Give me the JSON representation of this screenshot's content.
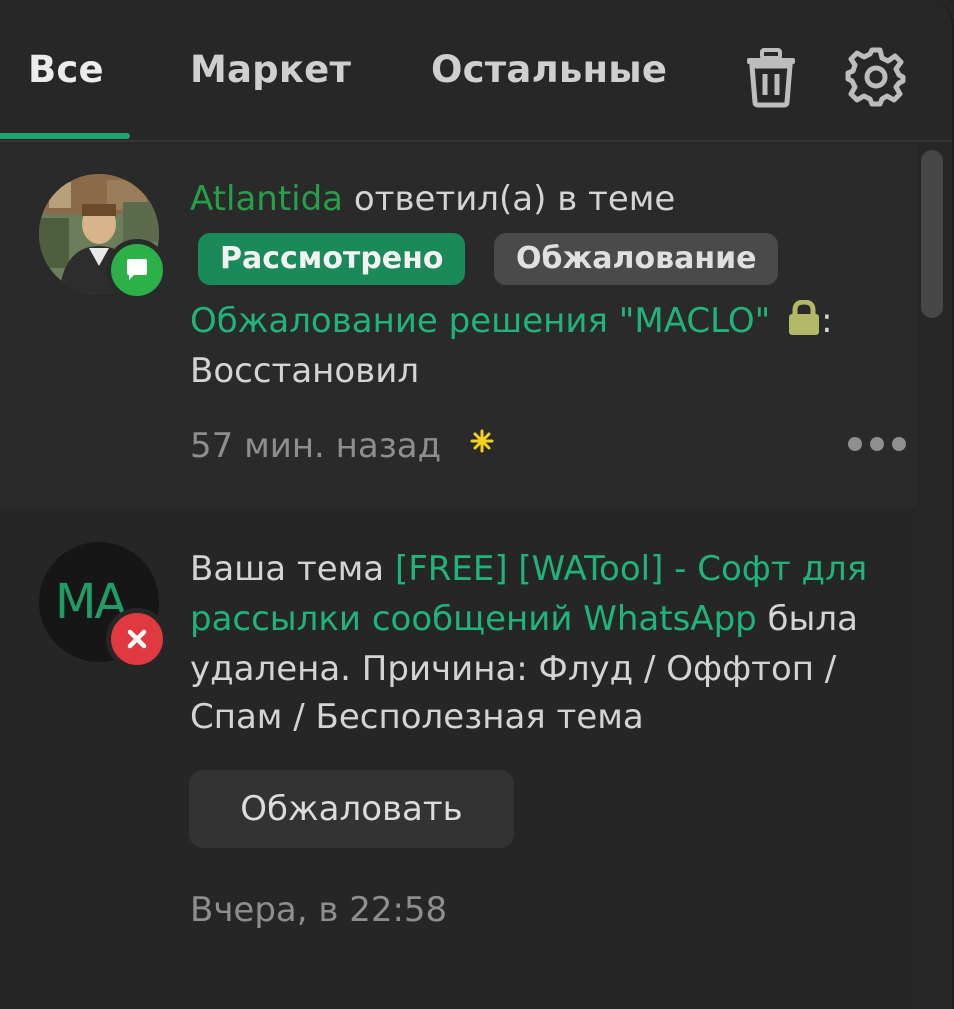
{
  "tabs": [
    {
      "label": "Все",
      "active": true
    },
    {
      "label": "Маркет",
      "active": false
    },
    {
      "label": "Остальные",
      "active": false
    }
  ],
  "toolbar": {
    "trash_icon": "trash-icon",
    "settings_icon": "gear-icon"
  },
  "accent_color": "#1fa36b",
  "notifications": [
    {
      "user": "Atlantida",
      "action": " ответил(а) в теме",
      "tags": [
        "Рассмотрено",
        "Обжалование"
      ],
      "thread_title": "Обжалование решения \"MACLO\"",
      "thread_suffix": ":",
      "message": "Восстановил",
      "time": "57 мин. назад",
      "badge_icon": "chat-bubble-icon"
    },
    {
      "avatar_initials": "MA",
      "prefix": "Ваша тема ",
      "thread_title_line1": "[FREE] [WATool] - Софт для",
      "thread_title_line2": "рассылки сообщений WhatsApp",
      "after_title": " была",
      "line3": "удалена. Причина: Флуд / Оффтоп /",
      "line4": "Спам / Бесполезная тема",
      "appeal_button": "Обжаловать",
      "time": "Вчера, в 22:58",
      "badge_icon": "close-icon"
    }
  ]
}
